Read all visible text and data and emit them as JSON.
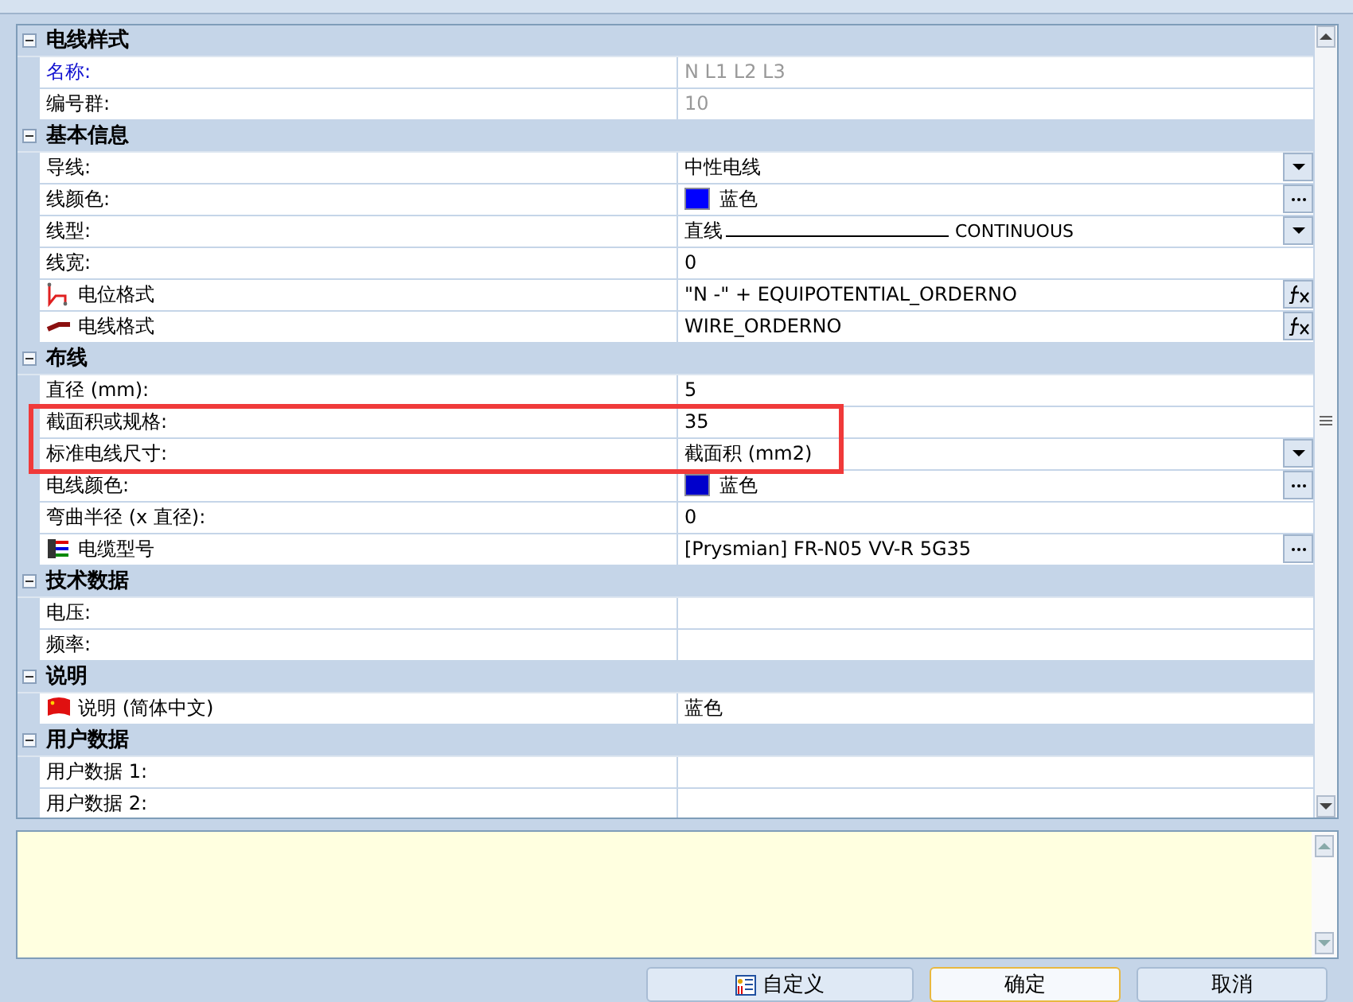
{
  "categories": [
    {
      "title": "电线样式",
      "expanded": true,
      "rows": [
        {
          "label": "名称:",
          "emphasized": true,
          "disabled": true,
          "value": "N L1 L2 L3",
          "kind": "text"
        },
        {
          "label": "编号群:",
          "emphasized": false,
          "disabled": true,
          "value": "10",
          "kind": "text"
        }
      ]
    },
    {
      "title": "基本信息",
      "expanded": true,
      "rows": [
        {
          "label": "导线:",
          "emphasized": false,
          "disabled": false,
          "value": "中性电线",
          "kind": "dropdown"
        },
        {
          "label": "线颜色:",
          "emphasized": false,
          "disabled": false,
          "value": "蓝色",
          "kind": "color",
          "color": "#0000ff"
        },
        {
          "label": "线型:",
          "emphasized": false,
          "disabled": false,
          "value": "直线",
          "suffix": "CONTINUOUS",
          "kind": "linetype"
        },
        {
          "label": "线宽:",
          "emphasized": false,
          "disabled": false,
          "value": "0",
          "kind": "text"
        },
        {
          "label": "电位格式",
          "emphasized": false,
          "disabled": false,
          "icon": {
            "kind": "potential"
          },
          "value": "\"N -\" + EQUIPOTENTIAL_ORDERNO",
          "kind": "formula"
        },
        {
          "label": "电线格式",
          "emphasized": false,
          "disabled": false,
          "icon": {
            "kind": "wire"
          },
          "value": "WIRE_ORDERNO",
          "kind": "formula"
        }
      ]
    },
    {
      "title": "布线",
      "expanded": true,
      "rows": [
        {
          "label": "直径 (mm):",
          "emphasized": false,
          "disabled": false,
          "value": "5",
          "kind": "text"
        },
        {
          "label": "截面积或规格:",
          "emphasized": false,
          "disabled": false,
          "value": "35",
          "kind": "text"
        },
        {
          "label": "标准电线尺寸:",
          "emphasized": false,
          "disabled": false,
          "value": "截面积 (mm2)",
          "kind": "dropdown"
        },
        {
          "label": "电线颜色:",
          "emphasized": false,
          "disabled": false,
          "value": "蓝色",
          "kind": "color",
          "color": "#0000cc"
        },
        {
          "label": "弯曲半径 (x 直径):",
          "emphasized": false,
          "disabled": false,
          "value": "0",
          "kind": "text"
        },
        {
          "label": "电缆型号",
          "emphasized": false,
          "disabled": false,
          "icon": {
            "kind": "cable"
          },
          "value": "[Prysmian] FR-N05 VV-R 5G35",
          "kind": "ellipsis"
        }
      ]
    },
    {
      "title": "技术数据",
      "expanded": true,
      "rows": [
        {
          "label": "电压:",
          "emphasized": false,
          "disabled": false,
          "value": "",
          "kind": "text"
        },
        {
          "label": "频率:",
          "emphasized": false,
          "disabled": false,
          "value": "",
          "kind": "text"
        }
      ]
    },
    {
      "title": "说明",
      "expanded": true,
      "rows": [
        {
          "label": "说明 (简体中文)",
          "emphasized": false,
          "disabled": false,
          "icon": {
            "kind": "flag"
          },
          "value": "蓝色",
          "kind": "text"
        }
      ]
    },
    {
      "title": "用户数据",
      "expanded": true,
      "rows": [
        {
          "label": "用户数据 1:",
          "emphasized": false,
          "disabled": false,
          "value": "",
          "kind": "text"
        },
        {
          "label": "用户数据 2:",
          "emphasized": false,
          "disabled": false,
          "value": "",
          "kind": "text"
        }
      ]
    }
  ],
  "buttons": [
    {
      "label": "自定义",
      "kind": "custom"
    },
    {
      "label": "确定",
      "kind": "default"
    },
    {
      "label": "取消",
      "kind": "normal"
    }
  ]
}
